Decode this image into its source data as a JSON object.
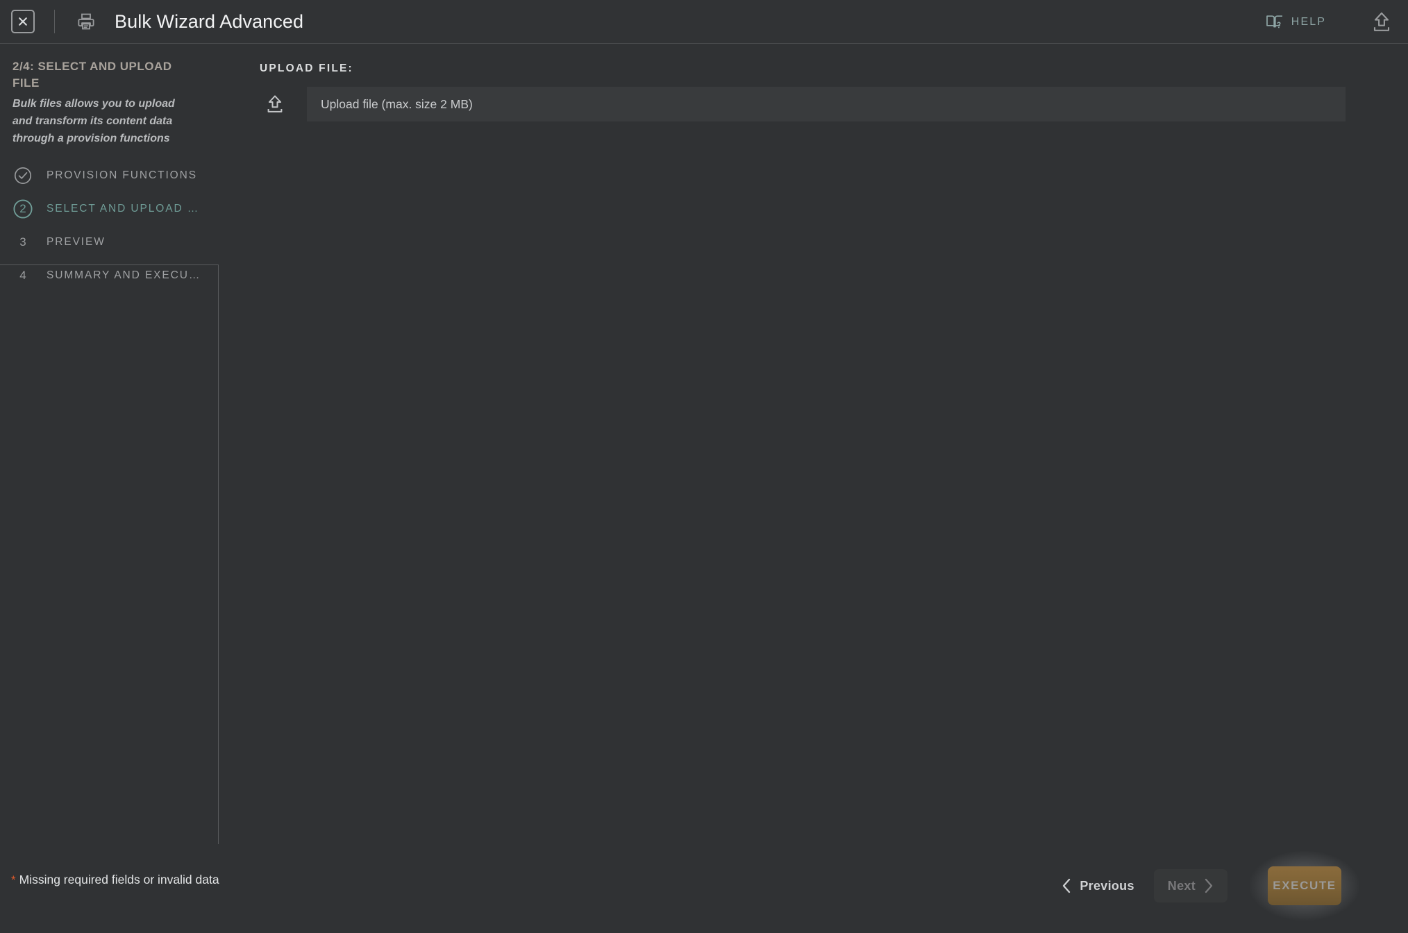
{
  "header": {
    "title": "Bulk Wizard Advanced",
    "close_icon": "close-box-icon",
    "print_icon": "printer-icon",
    "help_label": "HELP",
    "help_icon": "book-question-icon",
    "export_icon": "upload-export-icon"
  },
  "sidebar": {
    "title": "2/4: SELECT AND UPLOAD FILE",
    "description": "Bulk files allows you to upload and transform its content data through a provision functions",
    "steps": [
      {
        "number": "1",
        "label": "PROVISION FUNCTIONS",
        "state": "done",
        "marker": "check-circle-icon"
      },
      {
        "number": "2",
        "label": "SELECT AND UPLOAD …",
        "state": "active",
        "marker": "number-circle-icon"
      },
      {
        "number": "3",
        "label": "PREVIEW",
        "state": "pending",
        "marker": "number-icon"
      },
      {
        "number": "4",
        "label": "SUMMARY AND EXECU…",
        "state": "pending",
        "marker": "number-icon"
      }
    ]
  },
  "main": {
    "section_label": "UPLOAD FILE:",
    "upload_icon": "upload-arrow-icon",
    "upload_placeholder": "Upload file (max. size 2 MB)",
    "upload_value": ""
  },
  "footer": {
    "required_marker": "*",
    "message": "Missing required fields or invalid data",
    "previous_label": "Previous",
    "next_label": "Next",
    "execute_label": "EXECUTE",
    "prev_icon": "chevron-left-icon",
    "next_icon": "chevron-right-icon"
  },
  "colors": {
    "background": "#303234",
    "header_bg": "#313335",
    "field_bg": "#393b3d",
    "accent_teal": "#6f9c96",
    "help_teal": "#8fa6a6",
    "error_orange": "#e05a2b",
    "execute_gold": "#7d6236",
    "text_primary": "#e3e5e6",
    "text_muted": "#a0a2a4"
  }
}
